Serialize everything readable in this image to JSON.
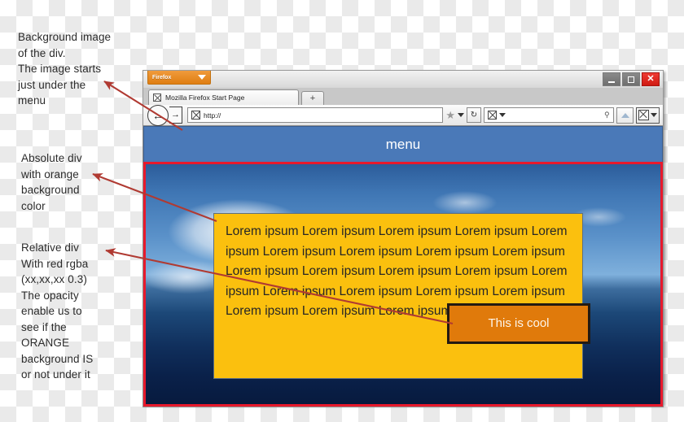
{
  "annotations": [
    {
      "id": "a1",
      "text": "Background image\nof the div.\nThe image starts\njust under the\nmenu"
    },
    {
      "id": "a2",
      "text": "Absolute div\nwith orange\nbackground\ncolor"
    },
    {
      "id": "a3",
      "text": "Relative div\nWith red rgba\n(xx,xx,xx 0.3)\nThe opacity\nenable us to\nsee if the\nORANGE\nbackground IS\nor not under it"
    }
  ],
  "browser": {
    "firefox_button_label": "Firefox",
    "firefox_caret_icon": "caret-down-icon",
    "window_controls": {
      "minimize_label": "–",
      "maximize_label": "□",
      "close_label": "✕"
    },
    "tab": {
      "favicon_icon": "page-favicon-icon",
      "title": "Mozilla Firefox Start Page",
      "new_tab_label": "+"
    },
    "toolbar": {
      "back_icon": "←",
      "forward_icon": "→",
      "url_icon": "site-identity-icon",
      "url_value": "http://",
      "url_placeholder": "http://",
      "bookmark_star_icon": "★",
      "bookmark_caret_icon": "caret-down-icon",
      "reload_icon": "↻",
      "search_engine_icon": "search-engine-icon",
      "search_caret_icon": "caret-down-icon",
      "search_value": "",
      "search_placeholder": "",
      "search_magnifier_icon": "⚲",
      "home_icon": "home-icon",
      "extra_icon": "toolbar-extra-icon",
      "extra_caret_icon": "caret-down-icon"
    }
  },
  "page": {
    "menu_label": "menu",
    "menu_bg_color": "#4a79b8",
    "relative_div_border_color": "#e8192c",
    "orange_div_bg_color": "#fbc00e",
    "orange_text": "Lorem ipsum Lorem ipsum Lorem ipsum Lorem ipsum Lorem ipsum Lorem ipsum Lorem ipsum Lorem ipsum Lorem ipsum Lorem ipsum Lorem ipsum Lorem ipsum Lorem ipsum Lorem ipsum Lorem ipsum Lorem ipsum Lorem ipsum Lorem ipsum Lorem ipsum Lorem ipsum Lorem ipsum",
    "cool_box_label": "This is cool",
    "cool_box_bg_color": "#e07a0b"
  }
}
